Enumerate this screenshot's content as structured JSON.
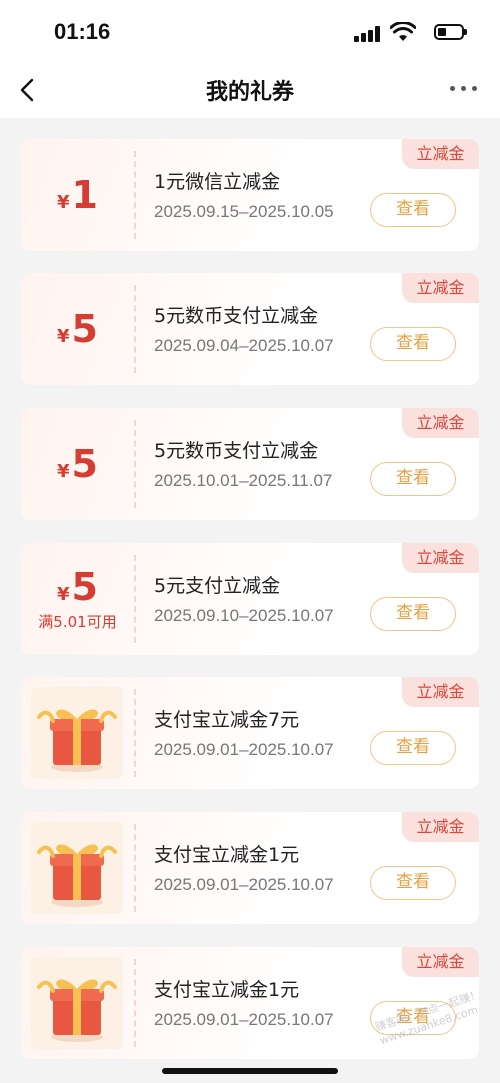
{
  "status_bar": {
    "time": "01:16"
  },
  "nav": {
    "title": "我的礼券"
  },
  "coupons": [
    {
      "type": "amount",
      "currency": "¥",
      "amount": "1",
      "condition": "",
      "tag": "立减金",
      "title": "1元微信立减金",
      "dates": "2025.09.15–2025.10.05",
      "button": "查看"
    },
    {
      "type": "amount",
      "currency": "¥",
      "amount": "5",
      "condition": "",
      "tag": "立减金",
      "title": "5元数币支付立减金",
      "dates": "2025.09.04–2025.10.07",
      "button": "查看"
    },
    {
      "type": "amount",
      "currency": "¥",
      "amount": "5",
      "condition": "",
      "tag": "立减金",
      "title": "5元数币支付立减金",
      "dates": "2025.10.01–2025.11.07",
      "button": "查看"
    },
    {
      "type": "amount",
      "currency": "¥",
      "amount": "5",
      "condition": "满5.01可用",
      "tag": "立减金",
      "title": "5元支付立减金",
      "dates": "2025.09.10–2025.10.07",
      "button": "查看"
    },
    {
      "type": "gift",
      "icon": "gift-box-icon",
      "tag": "立减金",
      "title": "支付宝立减金7元",
      "dates": "2025.09.01–2025.10.07",
      "button": "查看"
    },
    {
      "type": "gift",
      "icon": "gift-box-icon",
      "tag": "立减金",
      "title": "支付宝立减金1元",
      "dates": "2025.09.01–2025.10.07",
      "button": "查看"
    },
    {
      "type": "gift",
      "icon": "gift-box-icon",
      "tag": "立减金",
      "title": "支付宝立减金1元",
      "dates": "2025.09.01–2025.10.07",
      "button": "查看"
    }
  ],
  "watermark": "赚客吧，有点一起赚！ www.zuanke8.com",
  "colors": {
    "accent_red": "#d63d32",
    "tag_bg": "#fbe1dd",
    "button_border": "#f1c487",
    "button_text": "#e7a042"
  }
}
